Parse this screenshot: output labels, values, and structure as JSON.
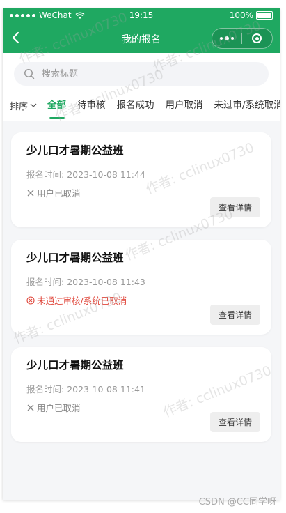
{
  "status_bar": {
    "carrier": "WeChat",
    "time": "19:15",
    "battery": "100%"
  },
  "nav": {
    "title": "我的报名"
  },
  "search": {
    "placeholder": "搜索标题",
    "value": ""
  },
  "sort": {
    "label": "排序"
  },
  "tabs": [
    {
      "label": "全部",
      "active": true
    },
    {
      "label": "待审核",
      "active": false
    },
    {
      "label": "报名成功",
      "active": false
    },
    {
      "label": "用户取消",
      "active": false
    },
    {
      "label": "未过审/系统取消",
      "active": false
    }
  ],
  "cards": [
    {
      "title": "少儿口才暑期公益班",
      "time_label": "报名时间:",
      "time_value": "2023-10-08 11:44",
      "status": "用户已取消",
      "status_type": "cancel",
      "button": "查看详情"
    },
    {
      "title": "少儿口才暑期公益班",
      "time_label": "报名时间:",
      "time_value": "2023-10-08 11:43",
      "status": "未通过审核/系统已取消",
      "status_type": "reject",
      "button": "查看详情"
    },
    {
      "title": "少儿口才暑期公益班",
      "time_label": "报名时间:",
      "time_value": "2023-10-08 11:41",
      "status": "用户已取消",
      "status_type": "cancel",
      "button": "查看详情"
    }
  ],
  "watermark": {
    "text": "作者: cclinux0730"
  },
  "footer": {
    "credit": "CSDN @CC同学呀"
  },
  "colors": {
    "brand": "#1fa861",
    "reject": "#e0483d",
    "muted": "#888888"
  }
}
